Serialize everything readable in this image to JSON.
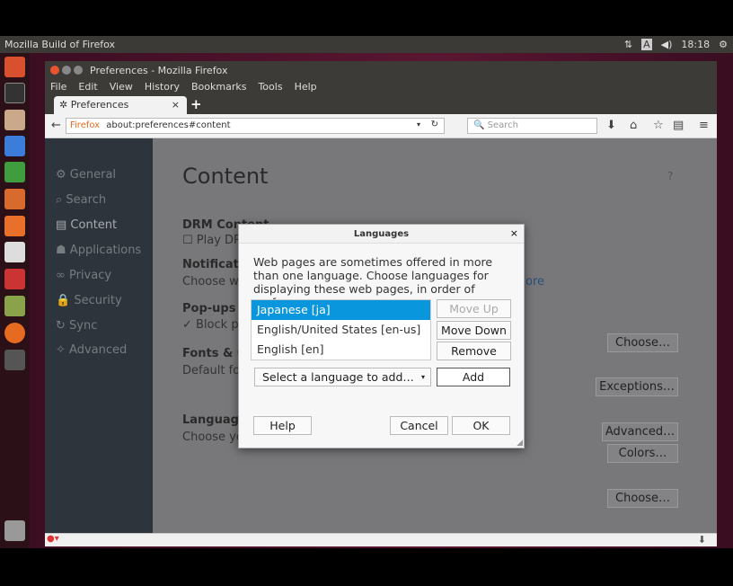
{
  "panel": {
    "title": "Mozilla Build of Firefox",
    "clock": "18:18",
    "keyboard": "A"
  },
  "window": {
    "title": "Preferences - Mozilla Firefox"
  },
  "menu": [
    "File",
    "Edit",
    "View",
    "History",
    "Bookmarks",
    "Tools",
    "Help"
  ],
  "tab": {
    "label": "Preferences"
  },
  "nav": {
    "identity": "Firefox",
    "url": "about:preferences#content",
    "search_placeholder": "Search"
  },
  "sidebar": {
    "items": [
      {
        "label": "General",
        "icon": "gear-icon"
      },
      {
        "label": "Search",
        "icon": "search-icon"
      },
      {
        "label": "Content",
        "icon": "content-icon"
      },
      {
        "label": "Applications",
        "icon": "applications-icon"
      },
      {
        "label": "Privacy",
        "icon": "mask-icon"
      },
      {
        "label": "Security",
        "icon": "lock-icon"
      },
      {
        "label": "Sync",
        "icon": "sync-icon"
      },
      {
        "label": "Advanced",
        "icon": "wizard-icon"
      }
    ]
  },
  "content": {
    "title": "Content",
    "drm": "DRM Content",
    "play_drm": "Play DRM",
    "notifications": "Notificati",
    "choose_which": "Choose wh",
    "learn_more": "ore",
    "choose_btn": "Choose…",
    "popups": "Pop-ups",
    "block_popups": "Block p",
    "exceptions_btn": "Exceptions…",
    "fonts": "Fonts & C",
    "default_font": "Default fo",
    "advanced_btn": "Advanced…",
    "colors_btn": "Colors…",
    "languages": "Language",
    "choose_your": "Choose yo",
    "choose_btn2": "Choose…"
  },
  "dialog": {
    "title": "Languages",
    "description": "Web pages are sometimes offered in more than one language. Choose languages for displaying these web pages, in order of preference:",
    "languages": [
      "Japanese  [ja]",
      "English/United States  [en-us]",
      "English  [en]"
    ],
    "move_up": "Move Up",
    "move_down": "Move Down",
    "remove": "Remove",
    "select_placeholder": "Select a language to add…",
    "add": "Add",
    "help": "Help",
    "cancel": "Cancel",
    "ok": "OK"
  },
  "colors": {
    "selection": "#0a96dc",
    "panel": "#3b3a36"
  }
}
